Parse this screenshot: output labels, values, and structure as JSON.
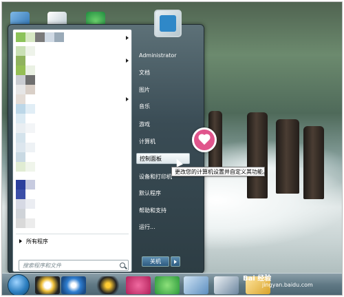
{
  "right_menu": {
    "user": "Administrator",
    "items": [
      "文档",
      "图片",
      "音乐",
      "游戏",
      "计算机",
      "控制面板",
      "设备和打印机",
      "默认程序",
      "帮助和支持",
      "运行..."
    ]
  },
  "tooltip": "更改您的计算机设置并自定义其功能。",
  "left_menu": {
    "all_programs": "所有程序",
    "search_placeholder": "搜索程序和文件"
  },
  "shutdown": "关机",
  "watermark": {
    "brand": "Bai 经验",
    "site": "jingyan.baidu.com"
  },
  "icons": [
    "start-orb-icon",
    "qq-icon",
    "ie-icon",
    "media-icon",
    "switcher-icon",
    "network-icon",
    "folder-icon",
    "heart-icon",
    "search-icon"
  ],
  "colors": {
    "accent": "#e0558c",
    "menu_bg": "#3a4c55",
    "highlight": "#dde6ea"
  }
}
